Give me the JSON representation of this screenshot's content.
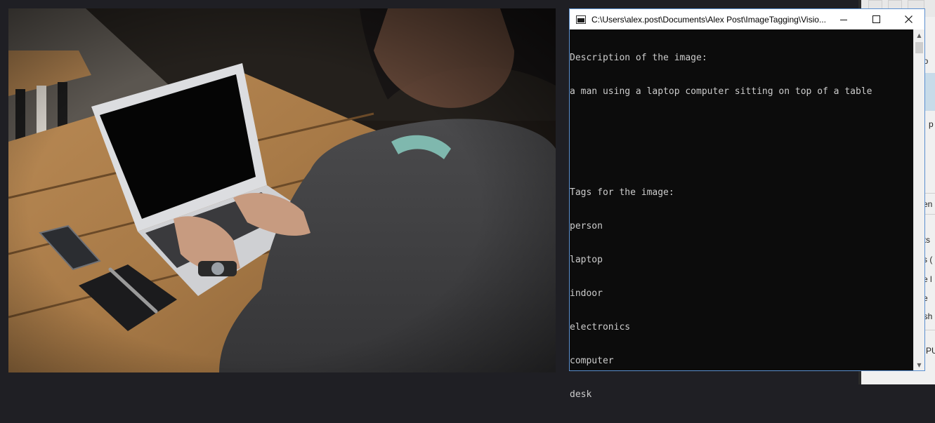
{
  "console": {
    "title": "C:\\Users\\alex.post\\Documents\\Alex Post\\ImageTagging\\Visio...",
    "controls": {
      "minimize": "minimize-icon",
      "maximize": "maximize-icon",
      "close": "close-icon"
    },
    "lines": [
      "Description of the image:",
      "a man using a laptop computer sitting on top of a table",
      "",
      "",
      "Tags for the image:",
      "person",
      "laptop",
      "indoor",
      "electronics",
      "computer",
      "desk"
    ]
  },
  "background_app": {
    "fragments": [
      "no",
      "p",
      "en",
      "nts",
      "s (",
      "e l",
      "e",
      "osh",
      "PU"
    ]
  },
  "colors": {
    "console_background": "#0c0c0c",
    "console_text": "#cccccc",
    "window_border": "#5a8fcf",
    "desktop": "#1f1f24"
  }
}
